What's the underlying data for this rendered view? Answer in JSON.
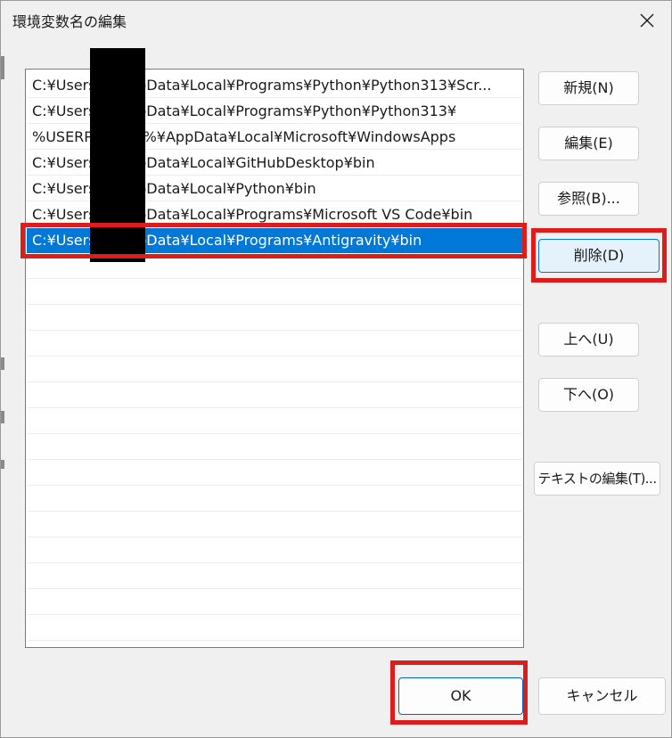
{
  "window": {
    "title": "環境変数名の編集",
    "close_icon": "close-icon"
  },
  "paths": [
    {
      "text": "C:¥Users¥        ¥AppData¥Local¥Programs¥Python¥Python313¥Scr...",
      "selected": false
    },
    {
      "text": "C:¥Users¥        ¥AppData¥Local¥Programs¥Python¥Python313¥",
      "selected": false
    },
    {
      "text": "%USERPROFILE%¥AppData¥Local¥Microsoft¥WindowsApps",
      "selected": false
    },
    {
      "text": "C:¥Users¥        ¥AppData¥Local¥GitHubDesktop¥bin",
      "selected": false
    },
    {
      "text": "C:¥Users¥        ¥AppData¥Local¥Python¥bin",
      "selected": false
    },
    {
      "text": "C:¥Users¥        ¥AppData¥Local¥Programs¥Microsoft VS Code¥bin",
      "selected": false
    },
    {
      "text": "C:¥Users¥        ¥AppData¥Local¥Programs¥Antigravity¥bin",
      "selected": true
    }
  ],
  "buttons": {
    "new": "新規(N)",
    "edit": "編集(E)",
    "browse": "参照(B)...",
    "delete": "削除(D)",
    "up": "上へ(U)",
    "down": "下へ(O)",
    "edit_text": "テキストの編集(T)...",
    "ok": "OK",
    "cancel": "キャンセル"
  },
  "colors": {
    "selection": "#0078d7",
    "highlight_box": "#dd1c1c"
  }
}
